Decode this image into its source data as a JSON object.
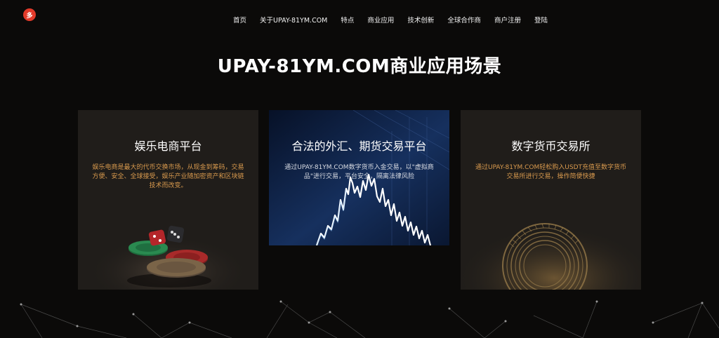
{
  "header": {
    "logo_text": "多",
    "nav": [
      "首页",
      "关于UPAY-81YM.COM",
      "特点",
      "商业应用",
      "技术创新",
      "全球合作商",
      "商户注册",
      "登陆"
    ]
  },
  "main": {
    "title": "UPAY-81YM.COM商业应用场景",
    "cards": [
      {
        "title": "娱乐电商平台",
        "desc": "娱乐电商是最大的代币交换市场，从现金到筹码，交易方便、安全、全球接受，娱乐产业随加密资产和区块链技术而改变。"
      },
      {
        "title": "合法的外汇、期货交易平台",
        "desc": "通过UPAY-81YM.COM数字货币入金交易，以\"虚拟商品\"进行交易，平台安全，隔离法律风险"
      },
      {
        "title": "数字货币交易所",
        "desc": "通过UPAY-81YM.COM轻松购入USDT充值至数字货币交易所进行交易，操作简便快捷"
      }
    ]
  },
  "colors": {
    "background": "#0b0a09",
    "card": "#201d1a",
    "accent_text": "#d99a4e",
    "logo": "#e23a2a"
  }
}
